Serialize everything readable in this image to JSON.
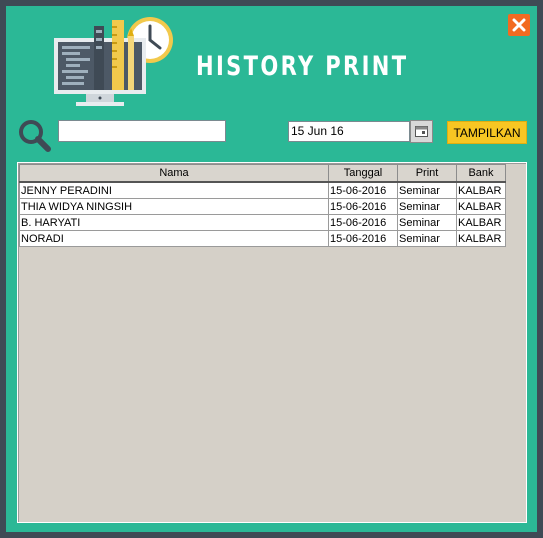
{
  "window": {
    "title": "HISTORY PRINT",
    "accent_color": "#2bb896",
    "close_icon": "close-x-icon"
  },
  "toolbar": {
    "search_placeholder": "",
    "search_value": "",
    "date_value": "15 Jun 16",
    "calendar_icon": "calendar-icon",
    "show_button_label": "TAMPILKAN"
  },
  "table": {
    "columns": [
      "Nama",
      "Tanggal",
      "Print",
      "Bank"
    ],
    "rows": [
      [
        "JENNY PERADINI",
        "15-06-2016",
        "Seminar",
        "KALBAR"
      ],
      [
        "THIA WIDYA NINGSIH",
        "15-06-2016",
        "Seminar",
        "KALBAR"
      ],
      [
        "B. HARYATI",
        "15-06-2016",
        "Seminar",
        "KALBAR"
      ],
      [
        "NORADI",
        "15-06-2016",
        "Seminar",
        "KALBAR"
      ]
    ]
  }
}
